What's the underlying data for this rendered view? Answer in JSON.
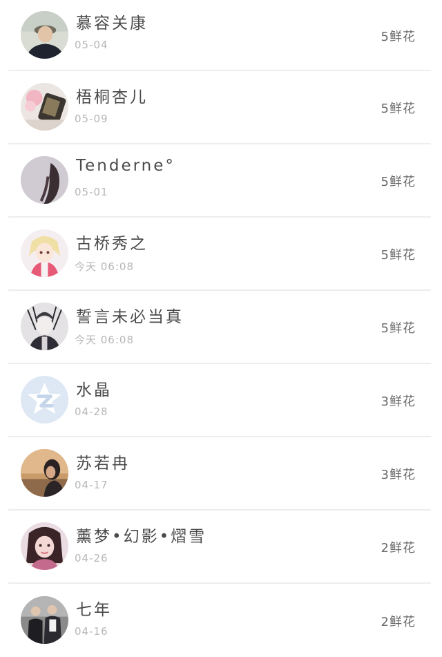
{
  "gift_list": {
    "items": [
      {
        "name": "慕容关康",
        "date": "05-04",
        "flowers": "5鲜花",
        "avatar": "user-photo-icon"
      },
      {
        "name": "梧桐杏儿",
        "date": "05-09",
        "flowers": "5鲜花",
        "avatar": "user-photo-icon"
      },
      {
        "name": "Tenderne°",
        "date": "05-01",
        "flowers": "5鲜花",
        "avatar": "user-photo-icon"
      },
      {
        "name": "古桥秀之",
        "date": "今天 06:08",
        "flowers": "5鲜花",
        "avatar": "anime-avatar-icon"
      },
      {
        "name": "誓言未必当真",
        "date": "今天 06:08",
        "flowers": "5鲜花",
        "avatar": "anime-avatar-icon"
      },
      {
        "name": "水晶",
        "date": "04-28",
        "flowers": "3鲜花",
        "avatar": "default-qzone-avatar-icon"
      },
      {
        "name": "苏若冉",
        "date": "04-17",
        "flowers": "3鲜花",
        "avatar": "user-photo-icon"
      },
      {
        "name": "薰梦•幻影•熠雪",
        "date": "04-26",
        "flowers": "2鲜花",
        "avatar": "user-photo-icon"
      },
      {
        "name": "七年",
        "date": "04-16",
        "flowers": "2鲜花",
        "avatar": "user-photo-icon"
      }
    ]
  },
  "colors": {
    "name_text": "#4a4a4a",
    "date_text": "#b6b6b6",
    "flowers_text": "#6a6a6a",
    "divider": "#ededed",
    "default_avatar_bg": "#dde8f4"
  }
}
